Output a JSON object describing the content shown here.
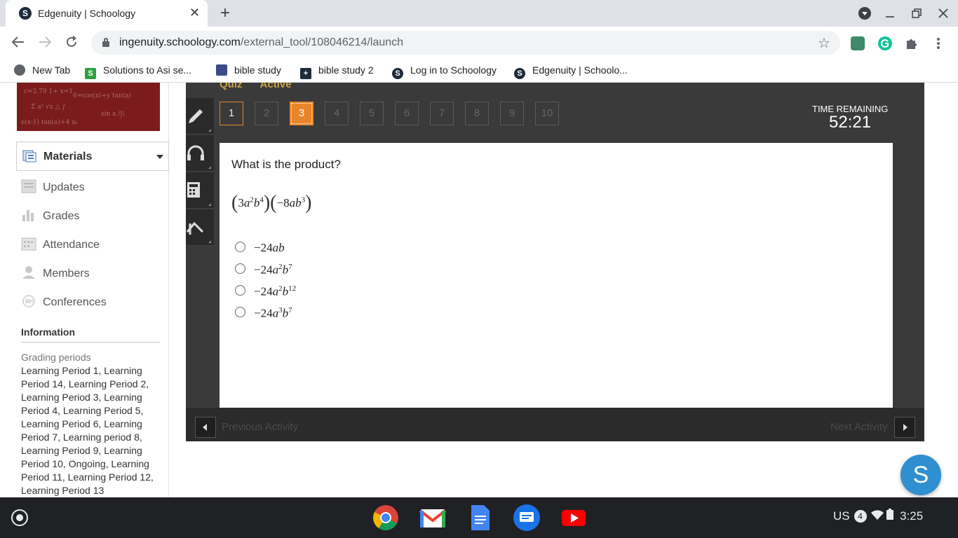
{
  "browser": {
    "tab_title": "Edgenuity | Schoology",
    "tab_close": "✕",
    "new_tab": "+",
    "favicon_letter": "S",
    "url_host": "ingenuity.schoology.com",
    "url_path": "/external_tool/108046214/launch"
  },
  "bookmarks": [
    {
      "label": "New Tab",
      "color": "#5f6368",
      "glyph": "◐"
    },
    {
      "label": "Solutions to Asi se...",
      "color": "#2ea043",
      "glyph": "S"
    },
    {
      "label": "bible study",
      "color": "#3b4b8a",
      "glyph": ""
    },
    {
      "label": "bible study 2",
      "color": "#1d2a3a",
      "glyph": "+"
    },
    {
      "label": "Log in to Schoology",
      "color": "#1d2a3a",
      "glyph": "S"
    },
    {
      "label": "Edgenuity | Schoolo...",
      "color": "#1d2a3a",
      "glyph": "S"
    }
  ],
  "sidebar": {
    "materials_label": "Materials",
    "nav": [
      {
        "label": "Updates",
        "icon": "updates-icon"
      },
      {
        "label": "Grades",
        "icon": "grades-icon"
      },
      {
        "label": "Attendance",
        "icon": "attendance-icon"
      },
      {
        "label": "Members",
        "icon": "members-icon"
      },
      {
        "label": "Conferences",
        "icon": "conferences-icon"
      }
    ],
    "info_heading": "Information",
    "grading_label": "Grading periods",
    "grading_text": "Learning Period 1, Learning Period 14, Learning Period 2, Learning Period 3, Learning Period 4, Learning Period 5, Learning Period 6, Learning Period 7, Learning period 8, Learning Period 9, Learning Period 10, Ongoing, Learning Period 11, Learning Period 12, Learning Period 13"
  },
  "quiz": {
    "header_left": "Quiz",
    "header_status": "Active",
    "numbers": [
      "1",
      "2",
      "3",
      "4",
      "5",
      "6",
      "7",
      "8",
      "9",
      "10"
    ],
    "visited": "1",
    "current": "3",
    "time_label": "TIME REMAINING",
    "time_value": "52:21",
    "question": "What is the product?",
    "expression": {
      "left_coef": "3",
      "left_a_exp": "2",
      "left_b_exp": "4",
      "right_coef": "−8",
      "right_b_exp": "3"
    },
    "choices": [
      {
        "coef": "−24",
        "a_exp": "",
        "b_exp": ""
      },
      {
        "coef": "−24",
        "a_exp": "2",
        "b_exp": "7"
      },
      {
        "coef": "−24",
        "a_exp": "2",
        "b_exp": "12"
      },
      {
        "coef": "−24",
        "a_exp": "3",
        "b_exp": "7"
      }
    ],
    "prev_label": "Previous Activity",
    "next_label": "Next Activity"
  },
  "fab_letter": "S",
  "shelf": {
    "locale": "US",
    "notif_count": "4",
    "time": "3:25"
  },
  "colors": {
    "accent_orange": "#e8852a",
    "player_bg": "#3a3a3a",
    "fab_blue": "#2f8fd0"
  }
}
